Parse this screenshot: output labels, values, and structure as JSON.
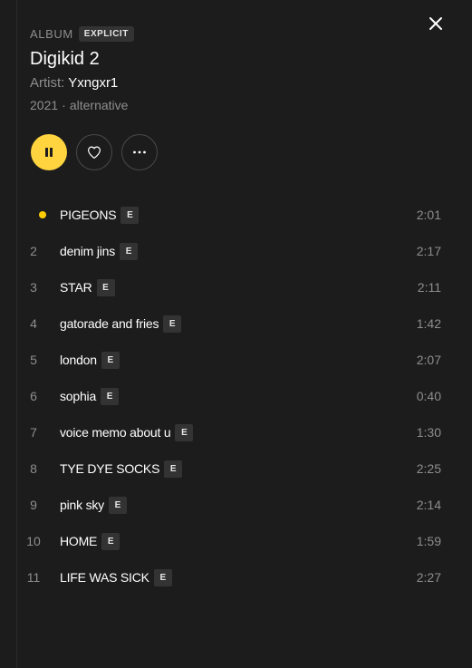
{
  "album": {
    "type_label": "ALBUM",
    "explicit_badge": "EXPLICIT",
    "title": "Digikid 2",
    "artist_label": "Artist:",
    "artist_name": "Yxngxr1",
    "year": "2021",
    "separator": "·",
    "genre": "alternative"
  },
  "controls": {
    "play_state": "playing",
    "accent_color": "#ffd43f"
  },
  "tracks": [
    {
      "num": "1",
      "title": "PIGEONS",
      "explicit": "E",
      "duration": "2:01",
      "now_playing": true
    },
    {
      "num": "2",
      "title": "denim jins",
      "explicit": "E",
      "duration": "2:17"
    },
    {
      "num": "3",
      "title": "STAR",
      "explicit": "E",
      "duration": "2:11"
    },
    {
      "num": "4",
      "title": "gatorade and fries",
      "explicit": "E",
      "duration": "1:42"
    },
    {
      "num": "5",
      "title": "london",
      "explicit": "E",
      "duration": "2:07"
    },
    {
      "num": "6",
      "title": "sophia",
      "explicit": "E",
      "duration": "0:40"
    },
    {
      "num": "7",
      "title": "voice memo about u",
      "explicit": "E",
      "duration": "1:30"
    },
    {
      "num": "8",
      "title": "TYE DYE SOCKS",
      "explicit": "E",
      "duration": "2:25"
    },
    {
      "num": "9",
      "title": "pink sky",
      "explicit": "E",
      "duration": "2:14"
    },
    {
      "num": "10",
      "title": "HOME",
      "explicit": "E",
      "duration": "1:59"
    },
    {
      "num": "11",
      "title": "LIFE WAS SICK",
      "explicit": "E",
      "duration": "2:27"
    }
  ]
}
